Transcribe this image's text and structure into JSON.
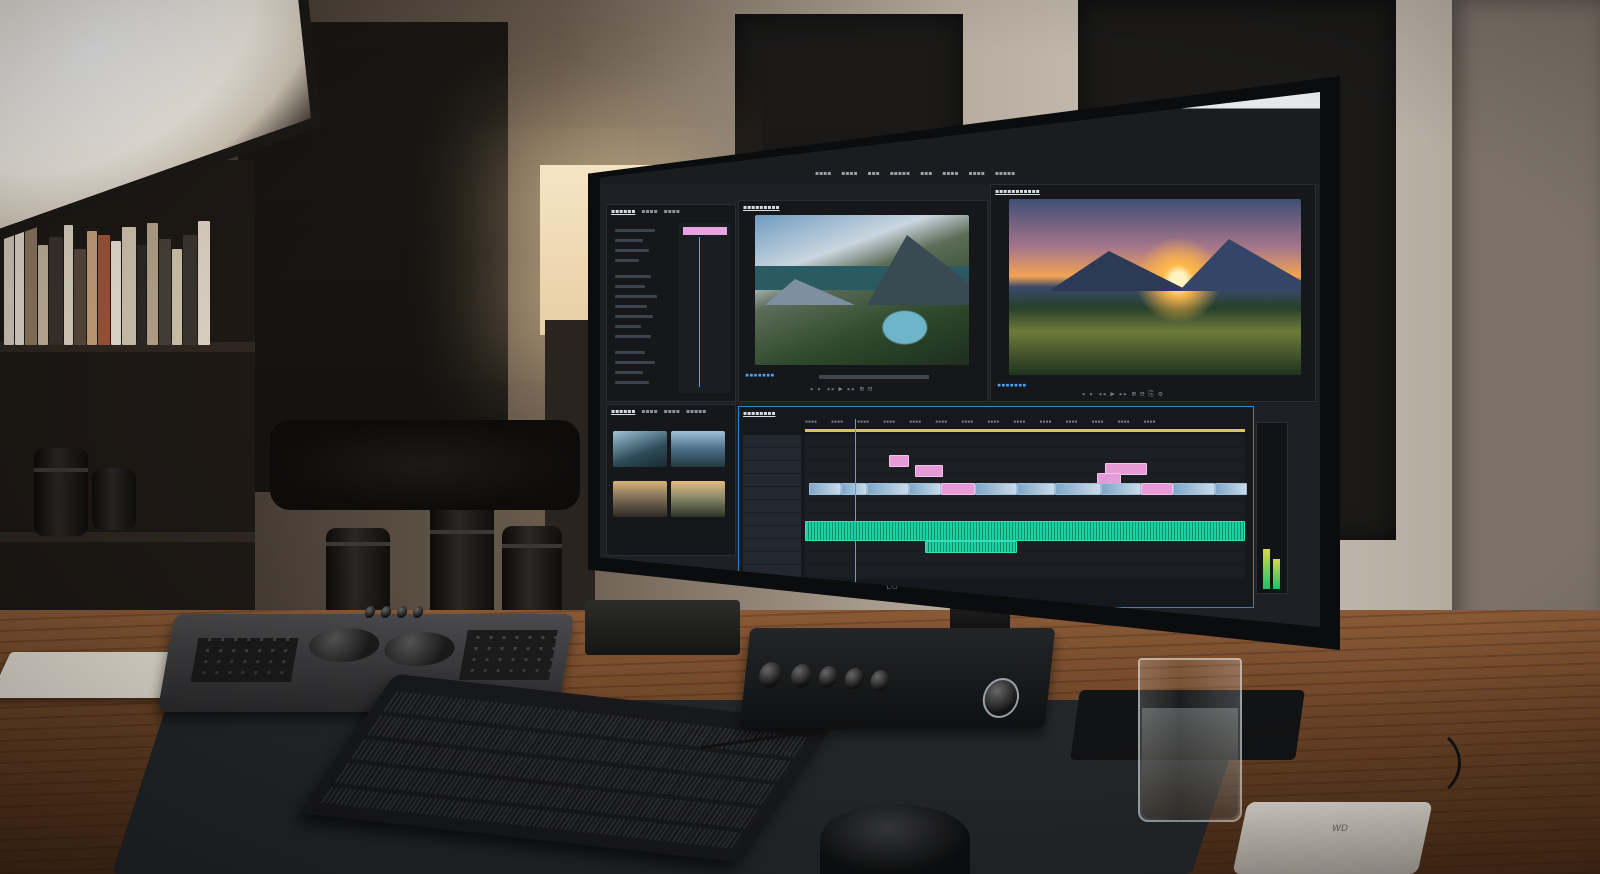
{
  "scene": {
    "subject": "video-editing-workstation",
    "colors": {
      "wall_warm": "#c9c1b5",
      "desk_wood": "#7a4d2e",
      "screen_bg": "#1d2024",
      "timeline_accent": "#2c86c9",
      "clip_pink": "#e69bd6",
      "clip_audio": "#1fd1a0",
      "sunset_orange": "#f2a352"
    },
    "icons": [
      "softbox-light",
      "bookshelf",
      "camera-lens",
      "control-surface",
      "keyboard",
      "audio-interface",
      "water-glass",
      "portable-ssd",
      "mouse",
      "monitor"
    ]
  },
  "monitor": {
    "brand_mark": "LG"
  },
  "devices": {
    "ssd_label": "WD"
  }
}
